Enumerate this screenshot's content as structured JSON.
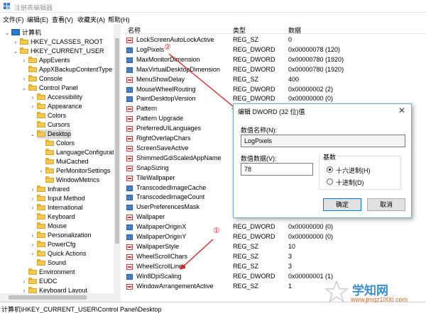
{
  "window": {
    "title": "注册表编辑器"
  },
  "menu": [
    "文件(F)",
    "编辑(E)",
    "查看(V)",
    "收藏夹(A)",
    "帮助(H)"
  ],
  "tree": [
    {
      "label": "计算机",
      "depth": 0,
      "expanded": true,
      "icon": "computer-icon"
    },
    {
      "label": "HKEY_CLASSES_ROOT",
      "depth": 1,
      "expanded": false
    },
    {
      "label": "HKEY_CURRENT_USER",
      "depth": 1,
      "expanded": true
    },
    {
      "label": "AppEvents",
      "depth": 2,
      "expanded": false
    },
    {
      "label": "AppXBackupContentType",
      "depth": 2,
      "expanded": null
    },
    {
      "label": "Console",
      "depth": 2,
      "expanded": false
    },
    {
      "label": "Control Panel",
      "depth": 2,
      "expanded": true
    },
    {
      "label": "Accessibility",
      "depth": 3,
      "expanded": false
    },
    {
      "label": "Appearance",
      "depth": 3,
      "expanded": false
    },
    {
      "label": "Colors",
      "depth": 3,
      "expanded": null
    },
    {
      "label": "Cursors",
      "depth": 3,
      "expanded": null
    },
    {
      "label": "Desktop",
      "depth": 3,
      "expanded": true,
      "selected": true
    },
    {
      "label": "Colors",
      "depth": 4,
      "expanded": null
    },
    {
      "label": "LanguageConfiguratio",
      "depth": 4,
      "expanded": null
    },
    {
      "label": "MuiCached",
      "depth": 4,
      "expanded": null
    },
    {
      "label": "PerMonitorSettings",
      "depth": 4,
      "expanded": false
    },
    {
      "label": "WindowMetrics",
      "depth": 4,
      "expanded": null
    },
    {
      "label": "Infrared",
      "depth": 3,
      "expanded": false
    },
    {
      "label": "Input Method",
      "depth": 3,
      "expanded": false
    },
    {
      "label": "International",
      "depth": 3,
      "expanded": false
    },
    {
      "label": "Keyboard",
      "depth": 3,
      "expanded": null
    },
    {
      "label": "Mouse",
      "depth": 3,
      "expanded": null
    },
    {
      "label": "Personalization",
      "depth": 3,
      "expanded": false
    },
    {
      "label": "PowerCfg",
      "depth": 3,
      "expanded": false
    },
    {
      "label": "Quick Actions",
      "depth": 3,
      "expanded": false
    },
    {
      "label": "Sound",
      "depth": 3,
      "expanded": null
    },
    {
      "label": "Environment",
      "depth": 2,
      "expanded": null
    },
    {
      "label": "EUDC",
      "depth": 2,
      "expanded": false
    },
    {
      "label": "Keyboard Layout",
      "depth": 2,
      "expanded": false
    }
  ],
  "columns": {
    "name": "名称",
    "type": "类型",
    "data": "数据"
  },
  "values": [
    {
      "name": "LockScreenAutoLockActive",
      "type": "REG_SZ",
      "data": "0",
      "icon": "ab"
    },
    {
      "name": "LogPixels",
      "type": "REG_DWORD",
      "data": "0x00000078 (120)",
      "icon": "bin"
    },
    {
      "name": "MaxMonitorDimension",
      "type": "REG_DWORD",
      "data": "0x00000780 (1920)",
      "icon": "bin"
    },
    {
      "name": "MaxVirtualDesktopDimension",
      "type": "REG_DWORD",
      "data": "0x00000780 (1920)",
      "icon": "bin"
    },
    {
      "name": "MenuShowDelay",
      "type": "REG_SZ",
      "data": "400",
      "icon": "ab"
    },
    {
      "name": "MouseWheelRouting",
      "type": "REG_DWORD",
      "data": "0x00000002 (2)",
      "icon": "bin"
    },
    {
      "name": "PaintDesktopVersion",
      "type": "REG_DWORD",
      "data": "0x00000000 (0)",
      "icon": "bin"
    },
    {
      "name": "Pattern",
      "type": "",
      "data": "",
      "icon": "ab"
    },
    {
      "name": "Pattern Upgrade",
      "type": "",
      "data": "",
      "icon": "ab"
    },
    {
      "name": "PreferredUILanguages",
      "type": "",
      "data": "",
      "icon": "ab"
    },
    {
      "name": "RightOverlapChars",
      "type": "",
      "data": "",
      "icon": "ab"
    },
    {
      "name": "ScreenSaveActive",
      "type": "",
      "data": "",
      "icon": "ab"
    },
    {
      "name": "ShimmedGdiScaledAppName",
      "type": "",
      "data": "",
      "icon": "ab"
    },
    {
      "name": "SnapSizing",
      "type": "",
      "data": "",
      "icon": "ab"
    },
    {
      "name": "TileWallpaper",
      "type": "",
      "data": "",
      "icon": "ab"
    },
    {
      "name": "TranscodedImageCache",
      "type": "",
      "data": "",
      "icon": "bin"
    },
    {
      "name": "TranscodedImageCount",
      "type": "",
      "data": "",
      "icon": "bin"
    },
    {
      "name": "UserPreferencesMask",
      "type": "",
      "data": "",
      "icon": "bin"
    },
    {
      "name": "Wallpaper",
      "type": "",
      "data": "",
      "icon": "ab"
    },
    {
      "name": "WallpaperOriginX",
      "type": "REG_DWORD",
      "data": "0x00000000 (0)",
      "icon": "bin"
    },
    {
      "name": "WallpaperOriginY",
      "type": "REG_DWORD",
      "data": "0x00000000 (0)",
      "icon": "bin"
    },
    {
      "name": "WallpaperStyle",
      "type": "REG_SZ",
      "data": "10",
      "icon": "ab"
    },
    {
      "name": "WheelScrollChars",
      "type": "REG_SZ",
      "data": "3",
      "icon": "ab"
    },
    {
      "name": "WheelScrollLines",
      "type": "REG_SZ",
      "data": "3",
      "icon": "ab"
    },
    {
      "name": "Win8DpiScaling",
      "type": "REG_DWORD",
      "data": "0x00000001 (1)",
      "icon": "bin"
    },
    {
      "name": "WindowArrangementActive",
      "type": "REG_SZ",
      "data": "1",
      "icon": "ab"
    }
  ],
  "dialog": {
    "title": "编辑 DWORD (32 位)值",
    "name_label": "数值名称(N):",
    "name_value": "LogPixels",
    "data_label": "数值数据(V):",
    "data_value": "78",
    "base_label": "基数",
    "hex_label": "十六进制(H)",
    "dec_label": "十进制(D)",
    "hex_selected": true,
    "ok": "确定",
    "cancel": "取消"
  },
  "markers": {
    "one": "①",
    "two": "②"
  },
  "status": "计算机\\HKEY_CURRENT_USER\\Control Panel\\Desktop",
  "watermark": {
    "main": "学知网",
    "url": "www.jmqz1000.com"
  },
  "colors": {
    "arrow": "#e02020",
    "folder": "#f3c84f"
  }
}
